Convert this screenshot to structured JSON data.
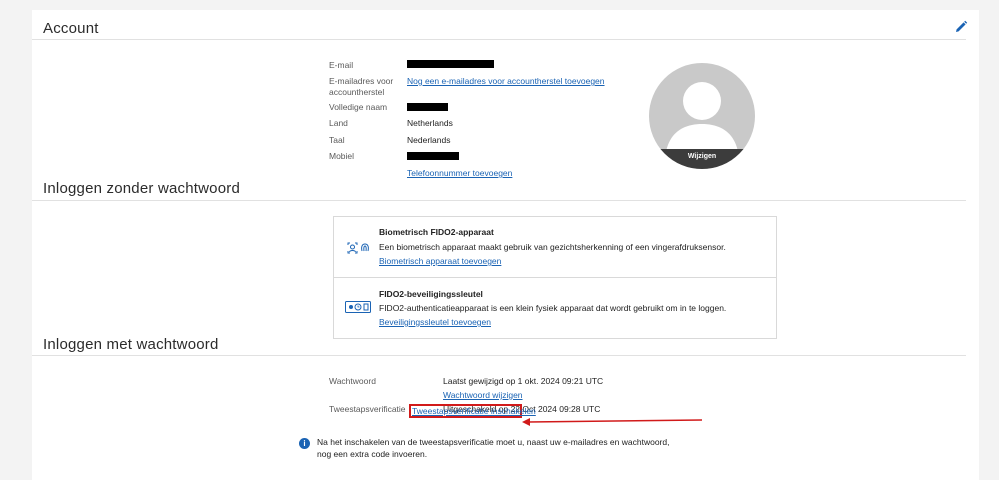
{
  "account": {
    "title": "Account",
    "fields": {
      "email_label": "E-mail",
      "recovery_label_line1": "E-mailadres voor",
      "recovery_label_line2": "accountherstel",
      "recovery_link": "Nog een e-mailadres voor accountherstel toevoegen",
      "fullname_label": "Volledige naam",
      "country_label": "Land",
      "country_value": "Netherlands",
      "language_label": "Taal",
      "language_value": "Nederlands",
      "mobile_label": "Mobiel",
      "phone_link": "Telefoonnummer toevoegen"
    },
    "avatar_change": "Wijzigen"
  },
  "passwordless": {
    "title": "Inloggen zonder wachtwoord",
    "biometric": {
      "title": "Biometrisch FIDO2-apparaat",
      "description": "Een biometrisch apparaat maakt gebruik van gezichtsherkenning of een vingerafdruksensor.",
      "link": "Biometrisch apparaat toevoegen",
      "icon": "face-fingerprint-icon"
    },
    "security_key": {
      "title": "FIDO2-beveiligingssleutel",
      "description": "FIDO2-authenticatieapparaat is een klein fysiek apparaat dat wordt gebruikt om in te loggen.",
      "link": "Beveiligingssleutel toevoegen",
      "icon": "security-key-icon"
    }
  },
  "password": {
    "title": "Inloggen met wachtwoord",
    "password_label": "Wachtwoord",
    "password_value": "Laatst gewijzigd op 1 okt. 2024 09:21 UTC",
    "password_link": "Wachtwoord wijzigen",
    "twostep_label": "Tweestapsverificatie",
    "twostep_value": "Uitgeschakeld op 22 Oct 2024 09:28 UTC",
    "twostep_link": "Tweestapsverificatie inschakelen",
    "info_line1": "Na het inschakelen van de tweestapsverificatie moet u, naast uw e-mailadres en wachtwoord,",
    "info_line2": "nog een extra code invoeren."
  },
  "colors": {
    "link": "#1a63b4",
    "highlight": "#d11a1a",
    "background": "#f3f3f3"
  }
}
